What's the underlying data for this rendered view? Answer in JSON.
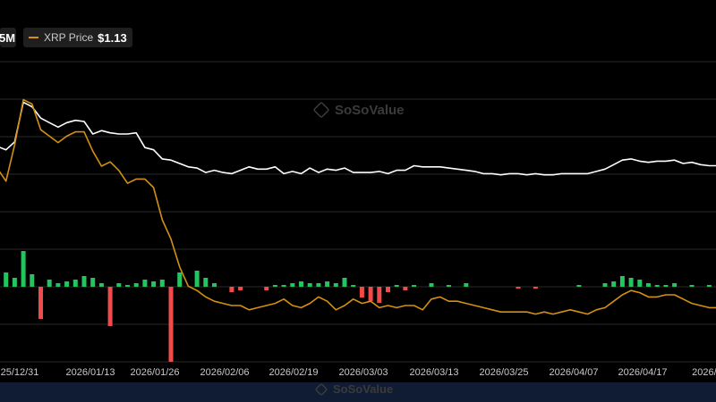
{
  "legend": {
    "left_value": "5M",
    "price_name": "XRP Price",
    "price_value": "$1.13"
  },
  "watermark": "SoSoValue",
  "colors": {
    "background": "#000000",
    "grid": "#2a2a2a",
    "price_line": "#d4900f",
    "white_line": "#ffffff",
    "inflow_bar": "#22c55e",
    "outflow_bar": "#f04a4a",
    "axis_text": "#c9c9c9",
    "navigator": "#101c33"
  },
  "chart_data": {
    "type": "bar",
    "x_tick_labels": [
      "25/12/31",
      "2026/01/13",
      "2026/01/26",
      "2026/02/06",
      "2026/02/19",
      "2026/03/03",
      "2026/03/13",
      "2026/03/25",
      "2026/04/07",
      "2026/04/17",
      "2026/0"
    ],
    "series": [
      {
        "name": "XRP Price",
        "kind": "line",
        "values": [
          2.04,
          1.98,
          2.15,
          2.36,
          2.34,
          2.22,
          2.19,
          2.16,
          2.19,
          2.21,
          2.21,
          2.12,
          2.05,
          2.07,
          2.03,
          1.97,
          1.99,
          1.99,
          1.95,
          1.8,
          1.71,
          1.58,
          1.49,
          1.47,
          1.44,
          1.42,
          1.41,
          1.4,
          1.4,
          1.38,
          1.39,
          1.4,
          1.41,
          1.43,
          1.4,
          1.39,
          1.41,
          1.44,
          1.42,
          1.38,
          1.4,
          1.43,
          1.41,
          1.42,
          1.39,
          1.4,
          1.39,
          1.4,
          1.4,
          1.38,
          1.43,
          1.44,
          1.42,
          1.42,
          1.41,
          1.4,
          1.39,
          1.38,
          1.37,
          1.37,
          1.37,
          1.37,
          1.36,
          1.37,
          1.36,
          1.37,
          1.38,
          1.37,
          1.36,
          1.38,
          1.39,
          1.42,
          1.45,
          1.47,
          1.46,
          1.44,
          1.44,
          1.45,
          1.45,
          1.43,
          1.41,
          1.4,
          1.39,
          1.39
        ]
      },
      {
        "name": "",
        "kind": "line",
        "values": [
          2.71,
          2.68,
          2.75,
          3.1,
          3.06,
          2.96,
          2.92,
          2.88,
          2.92,
          2.94,
          2.93,
          2.82,
          2.85,
          2.83,
          2.82,
          2.82,
          2.83,
          2.7,
          2.68,
          2.6,
          2.59,
          2.56,
          2.53,
          2.52,
          2.48,
          2.5,
          2.48,
          2.47,
          2.5,
          2.53,
          2.51,
          2.51,
          2.53,
          2.47,
          2.49,
          2.47,
          2.52,
          2.48,
          2.51,
          2.5,
          2.52,
          2.48,
          2.48,
          2.48,
          2.49,
          2.47,
          2.5,
          2.5,
          2.54,
          2.53,
          2.53,
          2.53,
          2.52,
          2.51,
          2.5,
          2.49,
          2.47,
          2.47,
          2.46,
          2.47,
          2.47,
          2.46,
          2.47,
          2.46,
          2.46,
          2.47,
          2.47,
          2.47,
          2.47,
          2.49,
          2.51,
          2.55,
          2.59,
          2.6,
          2.58,
          2.57,
          2.58,
          2.58,
          2.59,
          2.56,
          2.57,
          2.55,
          2.54,
          2.54
        ]
      },
      {
        "name": "",
        "kind": "bar",
        "values": [
          6,
          8,
          5,
          20,
          7,
          -18,
          4,
          2,
          3,
          4,
          6,
          5,
          2,
          -22,
          2,
          1,
          2,
          4,
          3,
          4,
          -42,
          8,
          0,
          9,
          5,
          2,
          0,
          -3,
          -2,
          0,
          0,
          -2,
          1,
          1,
          2,
          3,
          2,
          2,
          3,
          2,
          5,
          1,
          -6,
          -8,
          -9,
          -3,
          1,
          -2,
          1,
          0,
          2,
          0,
          1,
          0,
          2,
          0,
          0,
          0,
          0,
          0,
          -1,
          0,
          -1,
          0,
          0,
          0,
          0,
          1,
          0,
          0,
          2,
          3,
          6,
          5,
          4,
          2,
          1,
          1,
          2,
          0,
          1,
          0,
          1,
          0
        ]
      }
    ],
    "grid": true,
    "legend_placement": "top-left"
  }
}
